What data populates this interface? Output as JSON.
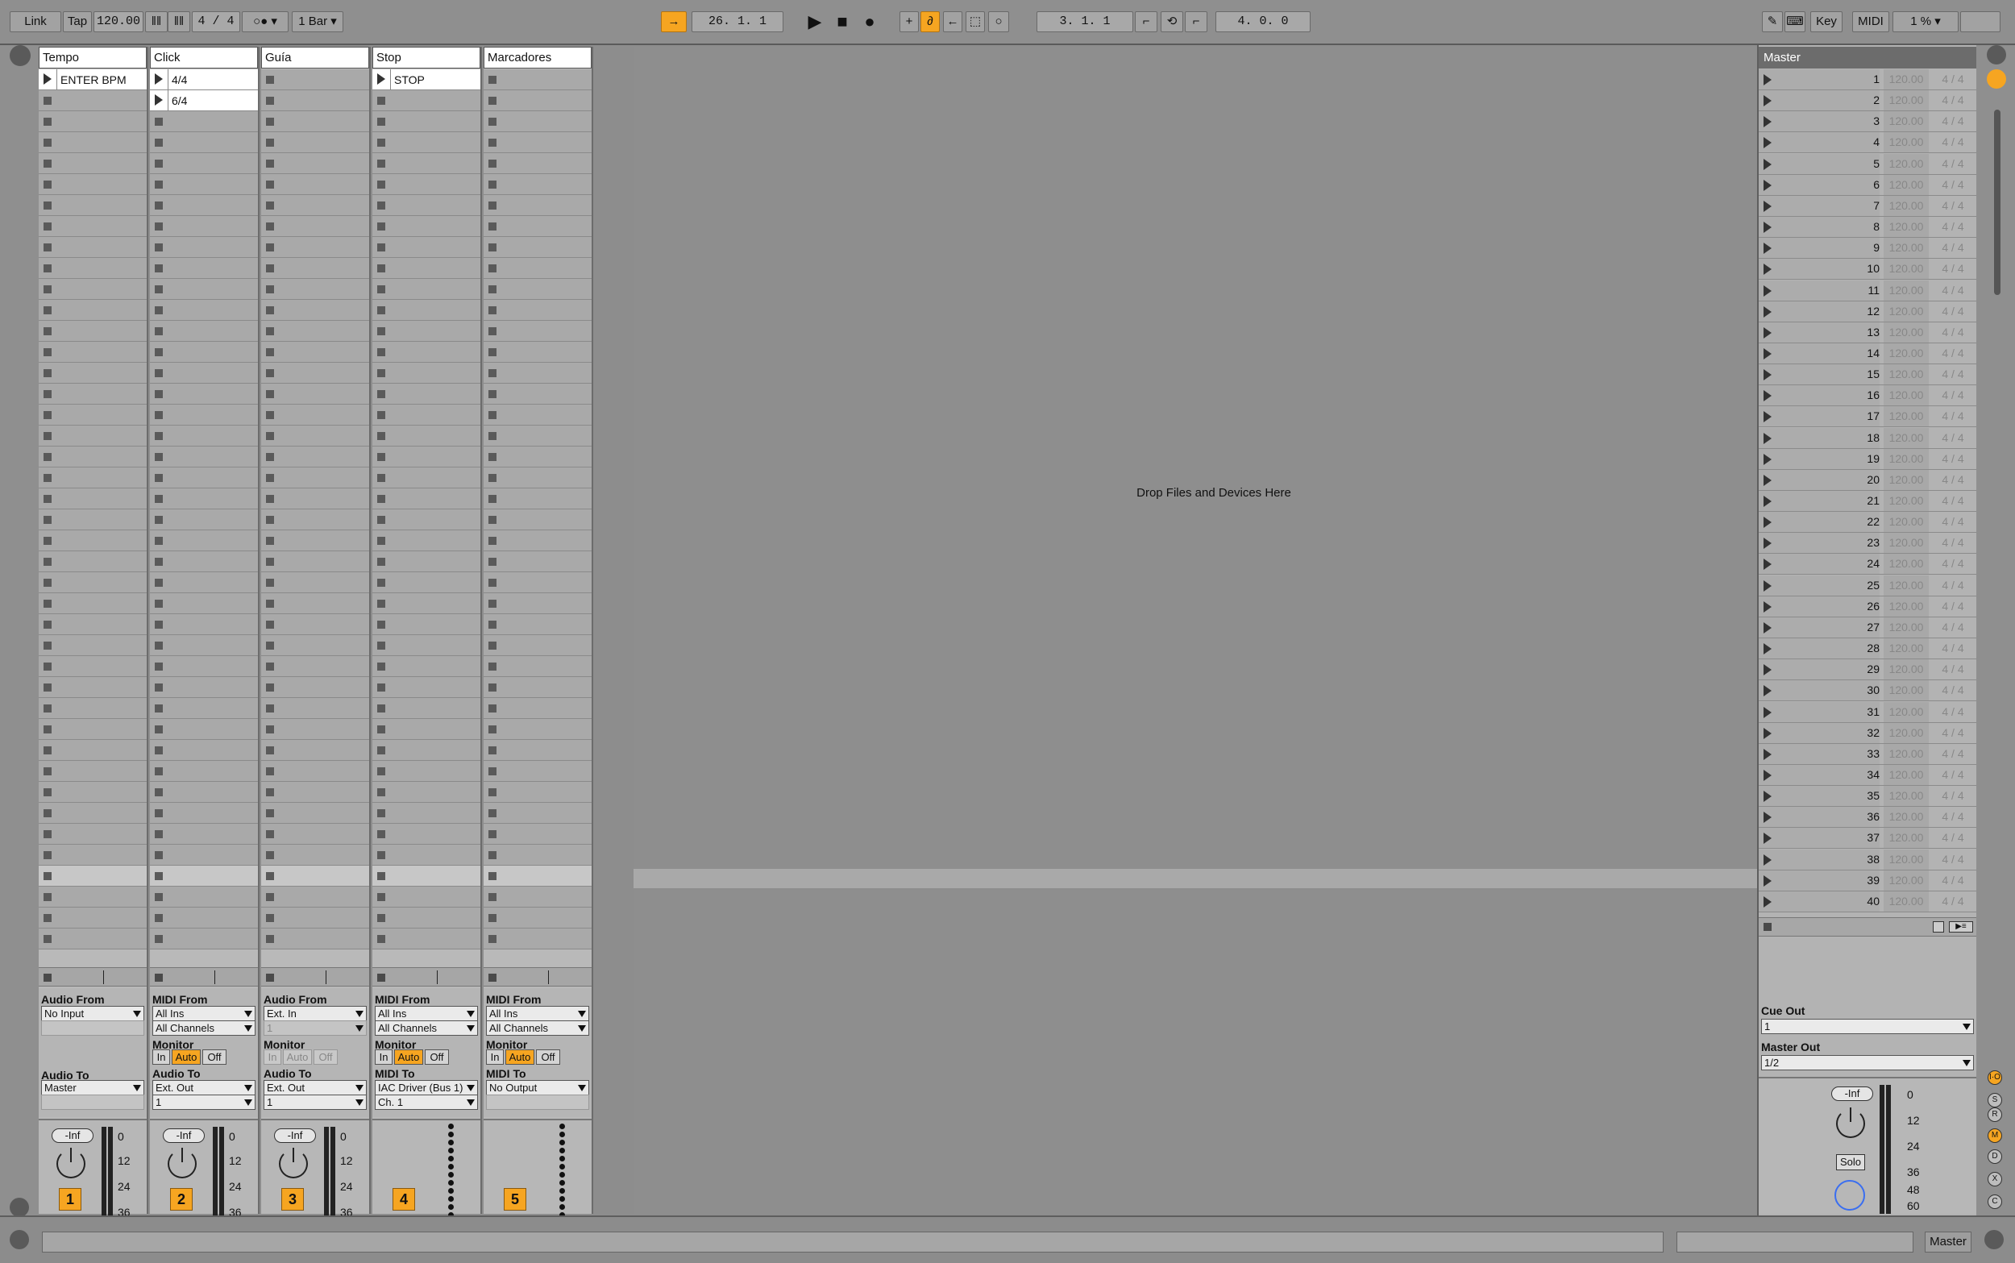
{
  "topbar": {
    "link": "Link",
    "tap": "Tap",
    "tempo": "120.00",
    "sig": "4 / 4",
    "quant": "1 Bar",
    "position": "26.  1.  1",
    "loop_start": "3.  1.  1",
    "loop_length": "4.  0.  0",
    "key": "Key",
    "midi": "MIDI",
    "cpu": "1 %",
    "accent": "#f6a521"
  },
  "tracks": [
    {
      "name": "Tempo",
      "from_label": "Audio From",
      "from": "No Input",
      "to_label": "Audio To",
      "to": "Master",
      "num": "1",
      "clips": [
        "ENTER BPM"
      ]
    },
    {
      "name": "Click",
      "from_label": "MIDI From",
      "from": "All Ins",
      "chan": "All Channels",
      "to_label": "Audio To",
      "to": "Ext. Out",
      "to_ch": "1",
      "num": "2",
      "clips": [
        "4/4",
        "6/4"
      ]
    },
    {
      "name": "Guía",
      "from_label": "Audio From",
      "from": "Ext. In",
      "chan": "1",
      "to_label": "Audio To",
      "to": "Ext. Out",
      "to_ch": "1",
      "num": "3",
      "clips": []
    },
    {
      "name": "Stop",
      "from_label": "MIDI From",
      "from": "All Ins",
      "chan": "All Channels",
      "to_label": "MIDI To",
      "to": "IAC Driver (Bus 1)",
      "to_ch": "Ch. 1",
      "num": "4",
      "clips": [
        "STOP"
      ]
    },
    {
      "name": "Marcadores",
      "from_label": "MIDI From",
      "from": "All Ins",
      "chan": "All Channels",
      "to_label": "MIDI To",
      "to": "No Output",
      "to_ch": "",
      "num": "5",
      "clips": []
    }
  ],
  "monitor": {
    "label": "Monitor",
    "in": "In",
    "auto": "Auto",
    "off": "Off"
  },
  "mixer": {
    "inf": "-Inf",
    "solo_short": "S",
    "scale": [
      "0",
      "12",
      "24",
      "36",
      "48",
      "60"
    ]
  },
  "drop_text": "Drop Files and Devices Here",
  "master": {
    "title": "Master",
    "tempo": "120.00",
    "sig": "4 / 4",
    "cue_out_label": "Cue Out",
    "cue_out": "1",
    "master_out_label": "Master Out",
    "master_out": "1/2",
    "solo": "Solo",
    "inf": "-Inf",
    "scenes": [
      "1",
      "2",
      "3",
      "4",
      "5",
      "6",
      "7",
      "8",
      "9",
      "10",
      "11",
      "12",
      "13",
      "14",
      "15",
      "16",
      "17",
      "18",
      "19",
      "20",
      "21",
      "22",
      "23",
      "24",
      "25",
      "26",
      "27",
      "28",
      "29",
      "30",
      "31",
      "32",
      "33",
      "34",
      "35",
      "36",
      "37",
      "38",
      "39",
      "40"
    ]
  },
  "status": {
    "master_label": "Master"
  }
}
